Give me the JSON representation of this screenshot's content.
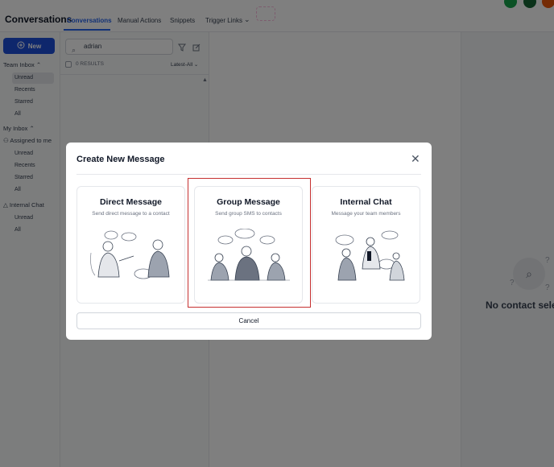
{
  "app": {
    "title": "Conversations"
  },
  "tabs": [
    {
      "label": "Conversations",
      "active": true
    },
    {
      "label": "Manual Actions"
    },
    {
      "label": "Snippets"
    },
    {
      "label": "Trigger Links"
    }
  ],
  "sidebar": {
    "new_label": "New",
    "team_inbox": {
      "label": "Team Inbox",
      "items": [
        "Unread",
        "Recents",
        "Starred",
        "All"
      ]
    },
    "my_inbox": {
      "label": "My Inbox"
    },
    "assigned": {
      "label": "Assigned to me",
      "items": [
        "Unread",
        "Recents",
        "Starred",
        "All"
      ]
    },
    "internal_chat": {
      "label": "Internal Chat",
      "items": [
        "Unread",
        "All"
      ]
    }
  },
  "list": {
    "search_value": "adrian",
    "results_label": "0 RESULTS",
    "sort_label": "Latest-All"
  },
  "right": {
    "empty_text": "No contact sele"
  },
  "modal": {
    "title": "Create New Message",
    "options": [
      {
        "title": "Direct Message",
        "desc": "Send direct message to a contact"
      },
      {
        "title": "Group Message",
        "desc": "Send group SMS to contacts",
        "highlighted": true
      },
      {
        "title": "Internal Chat",
        "desc": "Message your team members"
      }
    ],
    "cancel_label": "Cancel"
  },
  "colors": {
    "accent": "#2563eb",
    "new_button": "#1d4ed8",
    "highlight_border": "#c53030",
    "top_icons": [
      "#16a34a",
      "#166534",
      "#ea580c"
    ]
  }
}
